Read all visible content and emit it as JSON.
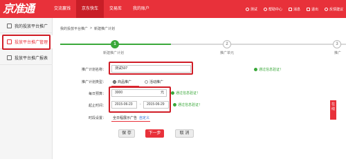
{
  "header": {
    "logo": "京准通",
    "nav": [
      "交流赢钱",
      "京东快车",
      "交易库",
      "我的账户"
    ],
    "user": {
      "username": "测试",
      "help": "帮助中心",
      "messages": "消息",
      "logout": "退出",
      "feedback": "反馈建议"
    }
  },
  "sidebar": {
    "items": [
      {
        "label": "我的投放平台推广"
      },
      {
        "label": "投放平台推广管理"
      },
      {
        "label": "投放平台推广报表"
      }
    ]
  },
  "breadcrumb": {
    "root": "我的投放平台推广",
    "separator": ">",
    "current": "新建推广计划"
  },
  "progress": {
    "steps": [
      {
        "number": "1",
        "label": "新建推广计划"
      },
      {
        "number": "2",
        "label": "推广单元"
      },
      {
        "number": "3",
        "label": "推广"
      }
    ]
  },
  "form": {
    "plan_name": {
      "label": "推广计划名称：",
      "value": "测试507",
      "status": "通过信息验证！"
    },
    "plan_type": {
      "label": "推广计划类型：",
      "options": [
        "商品推广",
        "活动推广"
      ],
      "selected": "商品推广"
    },
    "daily_budget": {
      "label": "每日预算：",
      "value": "3000",
      "unit": "元",
      "status": "通过信息验证！"
    },
    "date_range": {
      "label": "起止时间：",
      "start": "2015-06-23",
      "separator": "-",
      "end": "2015-06-29",
      "status": "通过信息验证！"
    },
    "schedule": {
      "label": "时段设置：",
      "value": "全日程展示广告",
      "action": "自定义"
    }
  },
  "buttons": {
    "save": "保 存",
    "next": "下一步",
    "cancel": "取 消"
  },
  "side_tab": "在线",
  "colors": {
    "brand": "#e8313a",
    "success": "#3aa83a",
    "highlight": "#d01c26"
  }
}
